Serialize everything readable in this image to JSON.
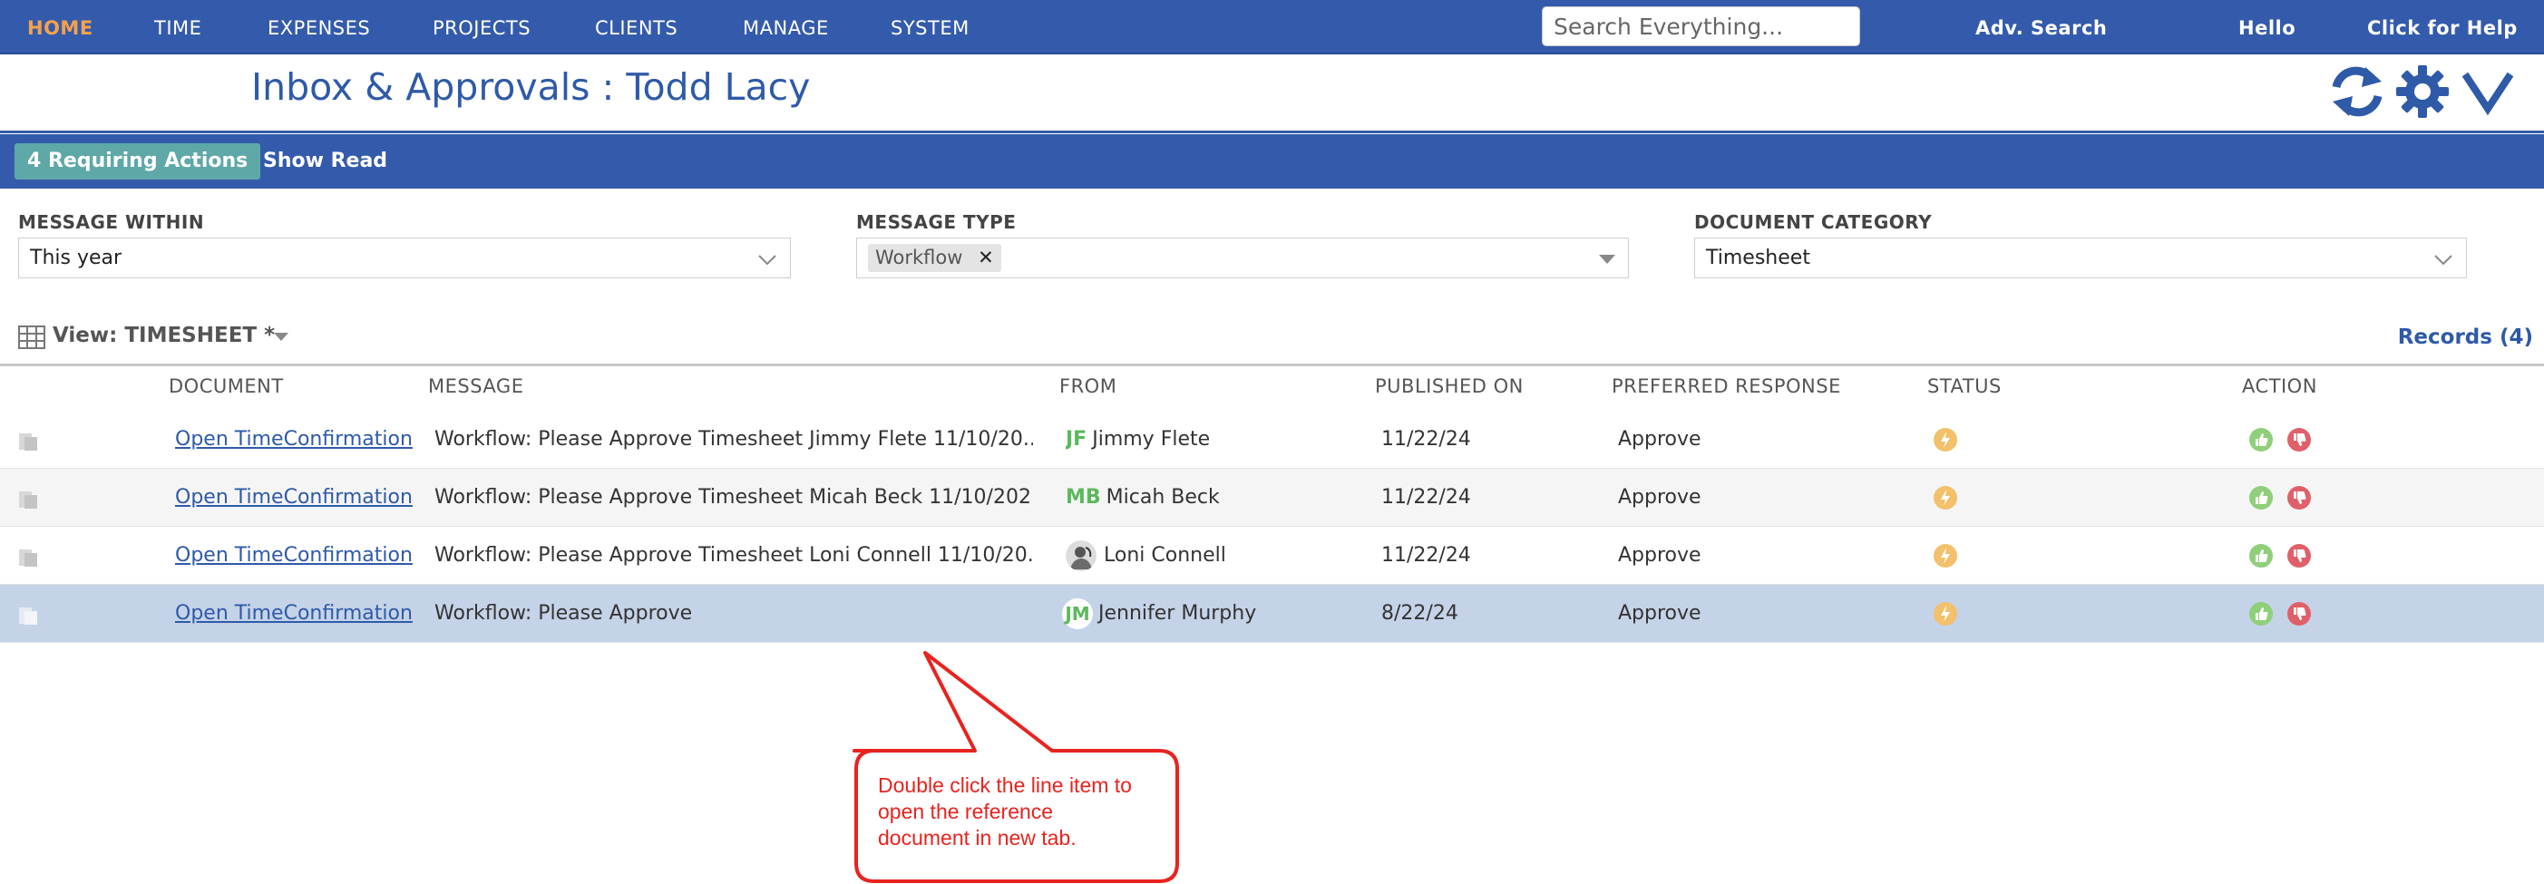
{
  "nav": {
    "items": [
      "HOME",
      "TIME",
      "EXPENSES",
      "PROJECTS",
      "CLIENTS",
      "MANAGE",
      "SYSTEM"
    ],
    "search_placeholder": "Search Everything...",
    "adv_search": "Adv. Search",
    "hello": "Hello",
    "help": "Click for Help"
  },
  "page": {
    "title": "Inbox & Approvals : Todd Lacy"
  },
  "actionbar": {
    "requiring_actions": "4 Requiring Actions",
    "show_read": "Show Read"
  },
  "filters": {
    "message_within": {
      "label": "MESSAGE WITHIN",
      "value": "This year"
    },
    "message_type": {
      "label": "MESSAGE TYPE",
      "tag": "Workflow",
      "remove": "✕"
    },
    "document_category": {
      "label": "DOCUMENT CATEGORY",
      "value": "Timesheet"
    }
  },
  "view": {
    "label": "View: TIMESHEET *",
    "records": "Records (4)"
  },
  "table": {
    "headers": [
      "DOCUMENT",
      "MESSAGE",
      "FROM",
      "PUBLISHED ON",
      "PREFERRED RESPONSE",
      "STATUS",
      "ACTION"
    ],
    "rows": [
      {
        "document": "Open TimeConfirmation",
        "message": "Workflow: Please Approve Timesheet Jimmy Flete 11/10/20...",
        "initials": "JF",
        "from": "Jimmy Flete",
        "published": "11/22/24",
        "response": "Approve"
      },
      {
        "document": "Open TimeConfirmation",
        "message": "Workflow: Please Approve Timesheet Micah Beck 11/10/202...",
        "initials": "MB",
        "from": "Micah Beck",
        "published": "11/22/24",
        "response": "Approve"
      },
      {
        "document": "Open TimeConfirmation",
        "message": "Workflow: Please Approve Timesheet Loni Connell 11/10/20...",
        "initials": "",
        "from": "Loni Connell",
        "published": "11/22/24",
        "response": "Approve"
      },
      {
        "document": "Open TimeConfirmation",
        "message": "Workflow: Please Approve",
        "initials": "JM",
        "from": "Jennifer Murphy",
        "published": "8/22/24",
        "response": "Approve"
      }
    ]
  },
  "annotation": {
    "text": "Double click the line item to open the reference document in new tab."
  },
  "colors": {
    "nav_bg": "#345bab",
    "home_active": "#f5a24a",
    "badge": "#5fa8a8",
    "selected_row": "#c5d3e8",
    "approve_green": "#8fcf7a",
    "reject_red": "#e0606a",
    "status_orange": "#f3c06b",
    "callout_red": "#e8231e"
  },
  "icons": [
    "refresh-icon",
    "gear-icon",
    "chevron-down-icon",
    "grid-icon",
    "document-icon",
    "lightning-icon",
    "thumbs-up-icon",
    "thumbs-down-icon"
  ]
}
